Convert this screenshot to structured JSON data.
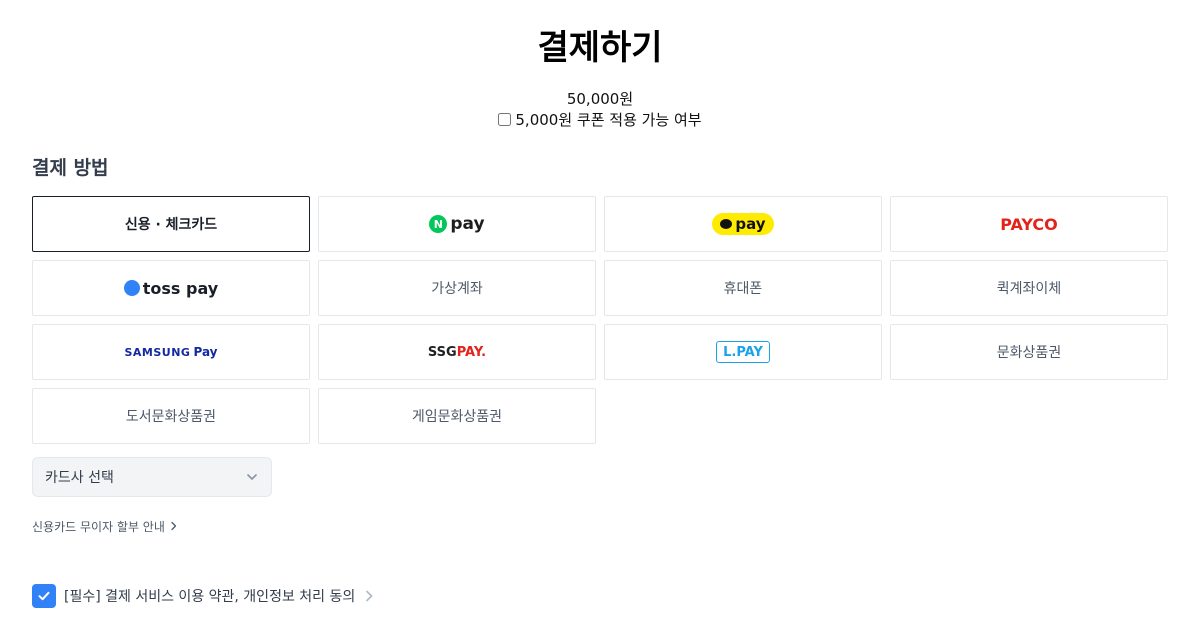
{
  "header": {
    "title": "결제하기",
    "amount": "50,000원",
    "coupon_label": "5,000원 쿠폰 적용 가능 여부"
  },
  "payment": {
    "section_title": "결제 방법",
    "methods": [
      {
        "id": "card",
        "label": "신용 · 체크카드",
        "selected": true
      },
      {
        "id": "npay",
        "label": "pay",
        "icon": "naver-pay-logo"
      },
      {
        "id": "kakaopay",
        "label": "pay",
        "icon": "kakao-pay-logo"
      },
      {
        "id": "payco",
        "label": "PAYCO",
        "icon": "payco-logo"
      },
      {
        "id": "tosspay",
        "label": "toss pay",
        "icon": "toss-pay-logo"
      },
      {
        "id": "virtual-account",
        "label": "가상계좌"
      },
      {
        "id": "phone",
        "label": "휴대폰"
      },
      {
        "id": "quick-transfer",
        "label": "퀵계좌이체"
      },
      {
        "id": "samsungpay",
        "label": "SAMSUNG",
        "label2": "Pay",
        "icon": "samsung-pay-logo"
      },
      {
        "id": "ssgpay",
        "label": "SSG",
        "label2": "PAY.",
        "icon": "ssg-pay-logo"
      },
      {
        "id": "lpay",
        "label": "L.PAY",
        "icon": "l-pay-logo"
      },
      {
        "id": "culture-gift",
        "label": "문화상품권"
      },
      {
        "id": "book-gift",
        "label": "도서문화상품권"
      },
      {
        "id": "game-gift",
        "label": "게임문화상품권"
      }
    ],
    "card_select": {
      "value": "카드사 선택"
    },
    "installment_link": "신용카드 무이자 할부 안내"
  },
  "agreement": {
    "label": "[필수] 결제 서비스 이용 약관, 개인정보 처리 동의",
    "checked": true
  },
  "colors": {
    "accent": "#3182f6",
    "text": "#333d4b",
    "border": "#e5e8eb"
  }
}
